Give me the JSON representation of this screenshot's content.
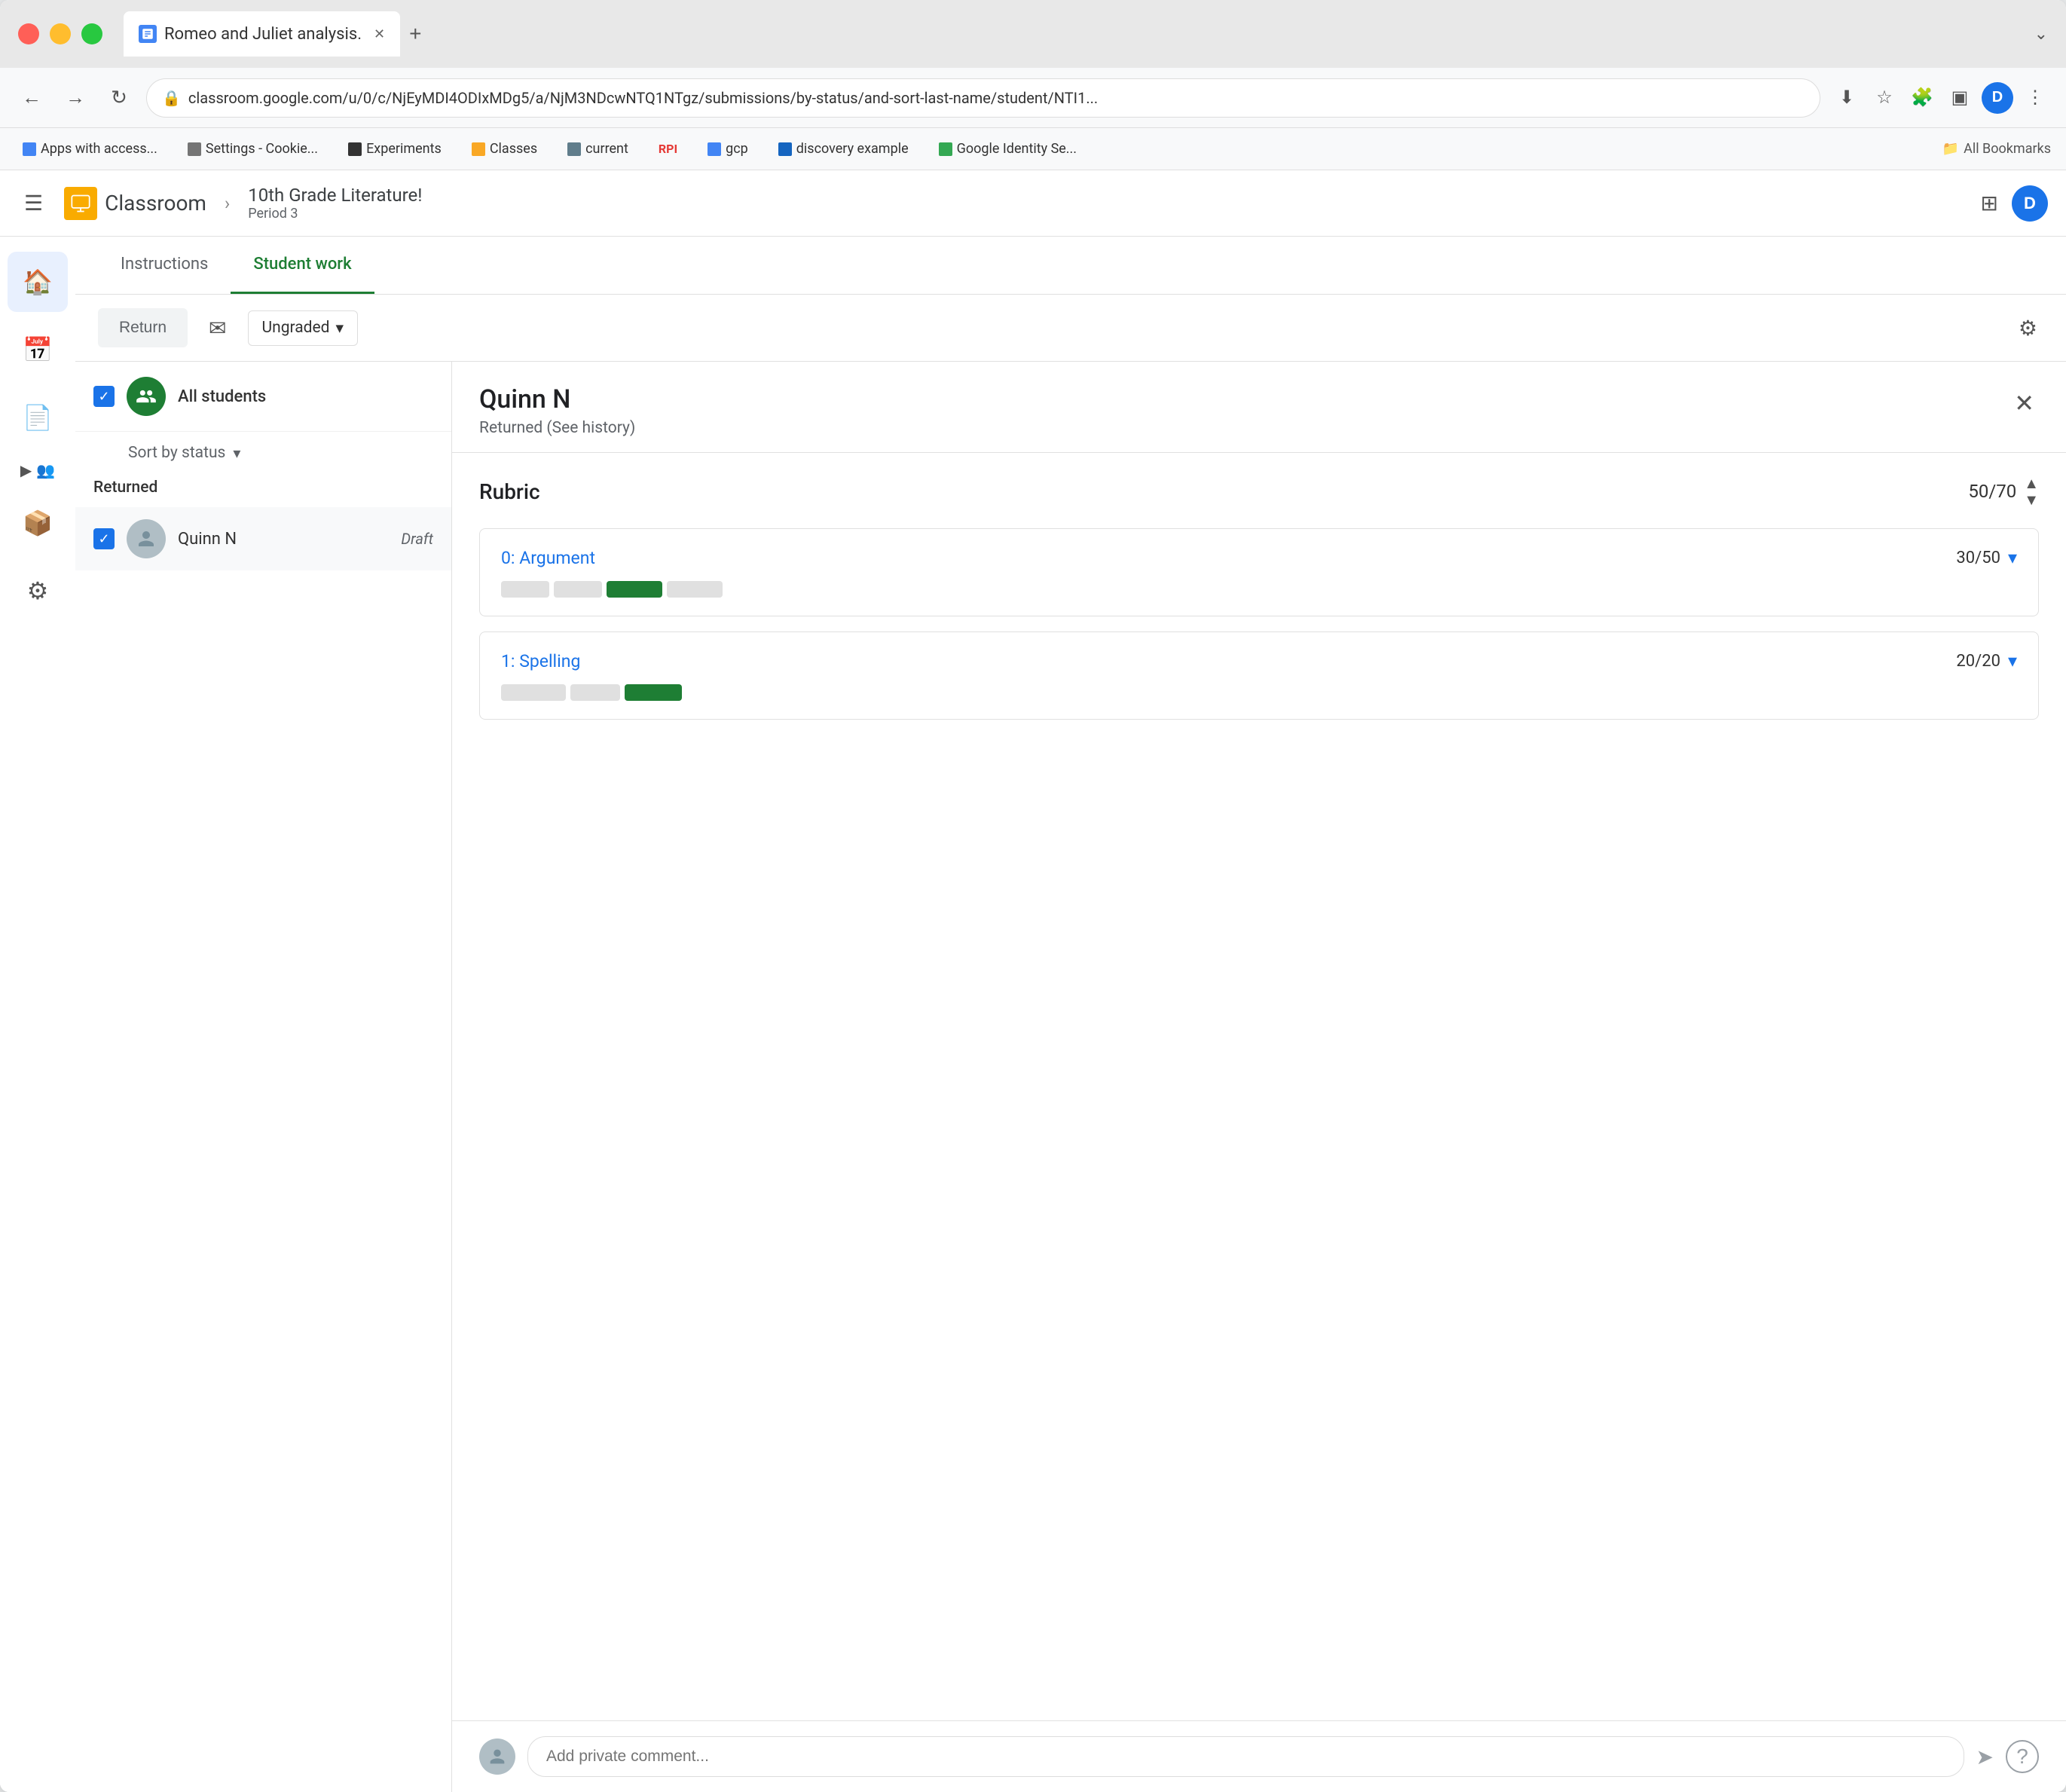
{
  "browser": {
    "tab_title": "Romeo and Juliet analysis.",
    "address": "classroom.google.com/u/0/c/NjEyMDI4ODIxMDg5/a/NjM3NDcwNTQ1NTgz/submissions/by-status/and-sort-last-name/student/NTI1...",
    "new_tab_label": "+",
    "maximize_label": "⌄",
    "bookmarks": [
      {
        "label": "Apps with access...",
        "type": "google"
      },
      {
        "label": "Settings - Cookie...",
        "type": "settings"
      },
      {
        "label": "Experiments",
        "type": "experiments"
      },
      {
        "label": "Classes",
        "type": "classes"
      },
      {
        "label": "current",
        "type": "current"
      },
      {
        "label": "gcp",
        "type": "gcp"
      },
      {
        "label": "discovery example",
        "type": "discovery"
      },
      {
        "label": "Google Identity Se...",
        "type": "google-id"
      }
    ],
    "all_bookmarks_label": "All Bookmarks"
  },
  "app": {
    "logo_text": "Classroom",
    "breadcrumb_sep": "›",
    "course_title": "10th Grade Literature!",
    "course_period": "Period 3",
    "hamburger_icon": "☰",
    "grid_icon": "⊞",
    "user_initial": "D"
  },
  "sidebar": {
    "items": [
      {
        "label": "home",
        "icon": "🏠"
      },
      {
        "label": "calendar",
        "icon": "📅"
      },
      {
        "label": "assignments",
        "icon": "📄"
      },
      {
        "label": "people",
        "icon": "👥"
      },
      {
        "label": "archive",
        "icon": "📦"
      },
      {
        "label": "settings",
        "icon": "⚙"
      }
    ]
  },
  "tabs": {
    "instructions_label": "Instructions",
    "student_work_label": "Student work"
  },
  "toolbar": {
    "return_label": "Return",
    "email_icon": "✉",
    "grade_label": "Ungraded",
    "grade_dropdown_icon": "▾",
    "settings_icon": "⚙"
  },
  "student_list": {
    "all_students_label": "All students",
    "sort_label": "Sort by status",
    "sort_arrow": "▾",
    "status_section_label": "Returned",
    "student": {
      "name": "Quinn N",
      "status": "Draft"
    }
  },
  "student_detail": {
    "name": "Quinn N",
    "status": "Returned (See history)",
    "close_icon": "✕",
    "rubric_title": "Rubric",
    "rubric_score": "50",
    "rubric_total": "70",
    "rubric_up_icon": "▲",
    "rubric_down_icon": "▼",
    "items": [
      {
        "name": "0: Argument",
        "score": "30",
        "total": "50",
        "segments": [
          {
            "type": "empty",
            "width": 60
          },
          {
            "type": "empty",
            "width": 60
          },
          {
            "type": "filled",
            "width": 70
          },
          {
            "type": "empty",
            "width": 70
          }
        ]
      },
      {
        "name": "1: Spelling",
        "score": "20",
        "total": "20",
        "segments": [
          {
            "type": "empty",
            "width": 80
          },
          {
            "type": "empty",
            "width": 60
          },
          {
            "type": "filled",
            "width": 70
          }
        ]
      }
    ],
    "comment_placeholder": "Add private comment...",
    "send_icon": "➤",
    "help_icon": "?"
  }
}
